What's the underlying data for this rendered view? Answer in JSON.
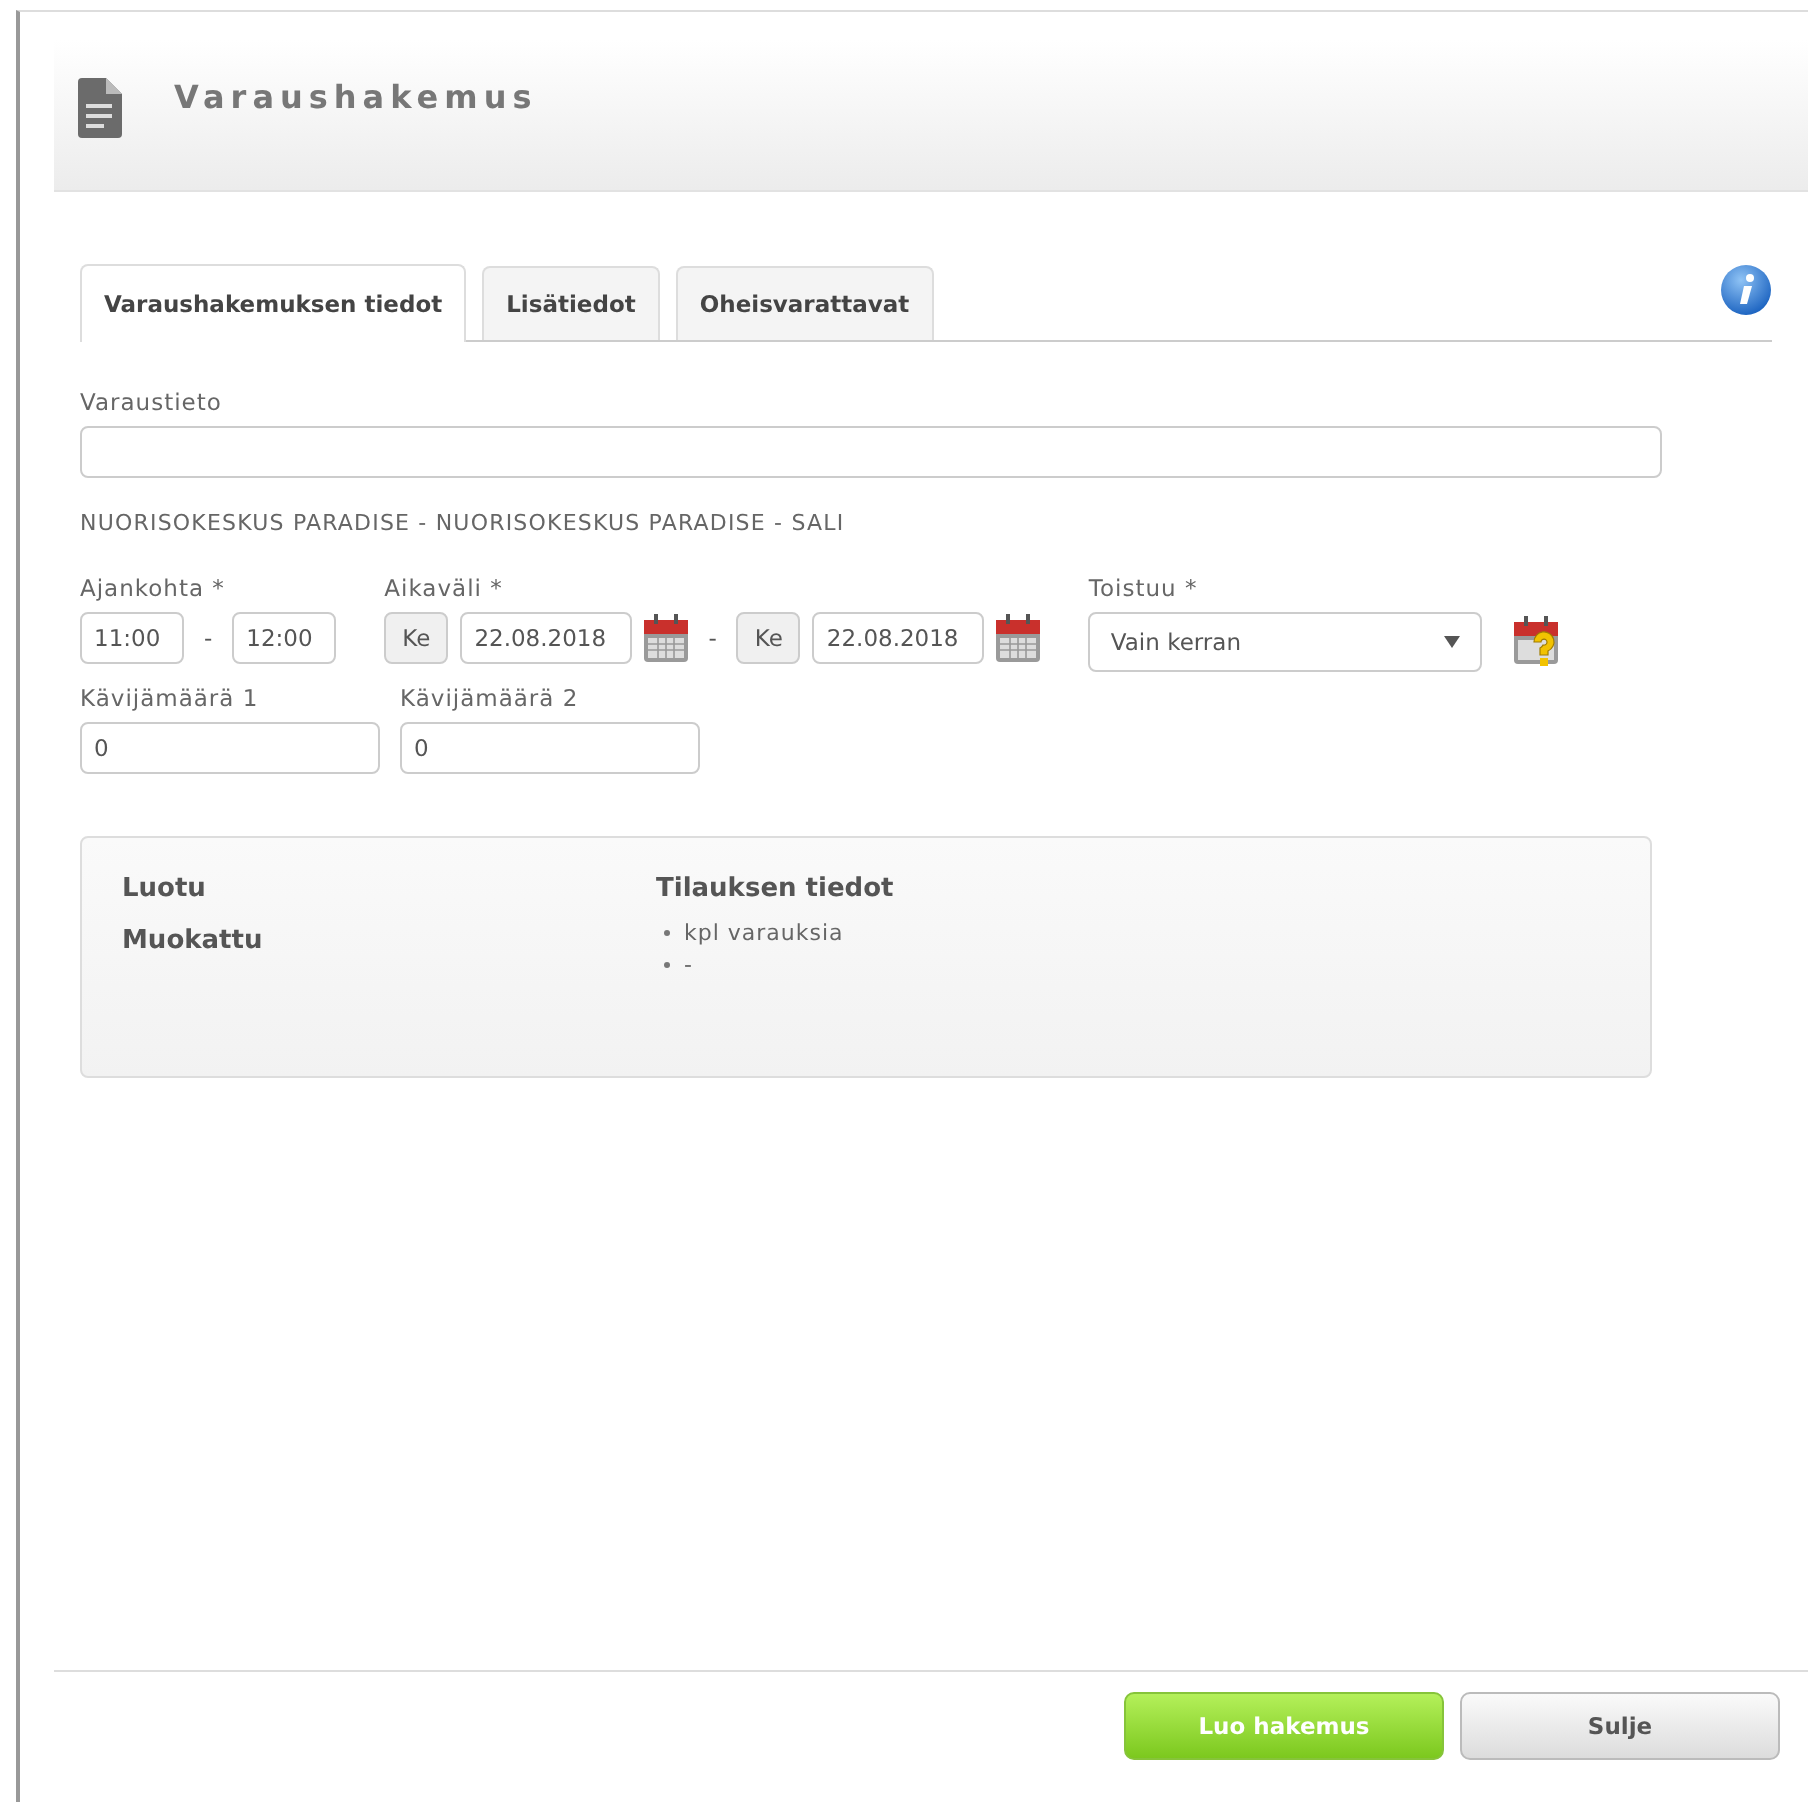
{
  "header": {
    "title": "Varaushakemus"
  },
  "tabs": [
    {
      "label": "Varaushakemuksen tiedot",
      "selected": true
    },
    {
      "label": "Lisätiedot",
      "selected": false
    },
    {
      "label": "Oheisvarattavat",
      "selected": false
    }
  ],
  "varaustieto": {
    "label": "Varaustieto"
  },
  "location": "NUORISOKESKUS PARADISE - NUORISOKESKUS PARADISE - SALI",
  "ajankohta": {
    "label": "Ajankohta *",
    "start": "11:00",
    "separator": "-",
    "end": "12:00"
  },
  "aikavali": {
    "label": "Aikaväli *",
    "start_day": "Ke",
    "start_date": "22.08.2018",
    "separator": "-",
    "end_day": "Ke",
    "end_date": "22.08.2018"
  },
  "toistuu": {
    "label": "Toistuu *",
    "value": "Vain kerran"
  },
  "counts": [
    {
      "label": "Kävijämäärä 1",
      "value": "0"
    },
    {
      "label": "Kävijämäärä 2",
      "value": "0"
    }
  ],
  "info_panel": {
    "labels": [
      "Luotu",
      "Muokattu"
    ],
    "order_title": "Tilauksen tiedot",
    "order_items": [
      "kpl varauksia",
      "-"
    ]
  },
  "buttons": [
    {
      "label": "Luo hakemus",
      "kind": "primary"
    },
    {
      "label": "Sulje",
      "kind": "secondary"
    }
  ]
}
